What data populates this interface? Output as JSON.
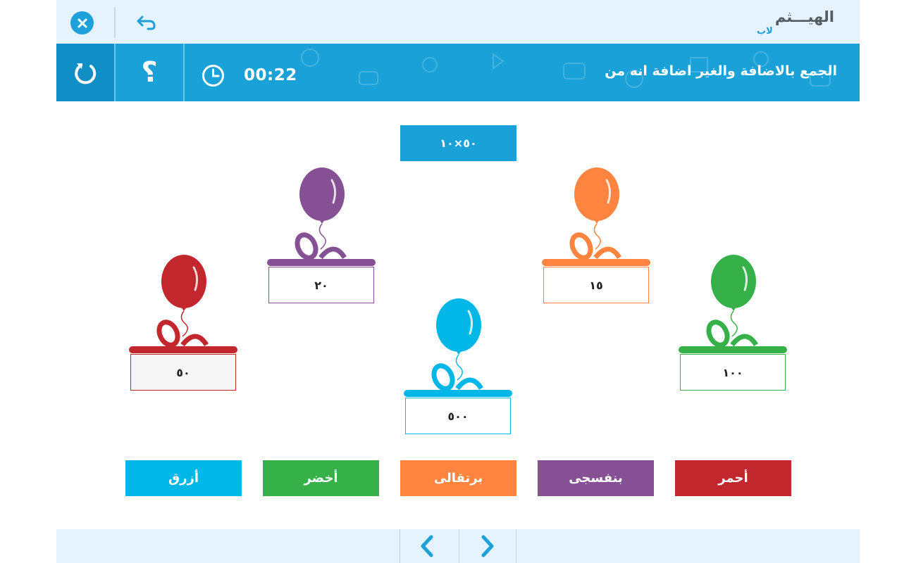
{
  "app": {
    "logo_text": "الهيـــثم",
    "logo_sub": "لاب"
  },
  "header": {
    "title": "الجمع بالاضافة والغير اضافة انه من",
    "timer": "00:22",
    "help_label": "؟"
  },
  "problem": {
    "text": "٥٠×١٠"
  },
  "gifts": [
    {
      "name": "red",
      "value": "٥٠",
      "color": "#c1272d"
    },
    {
      "name": "purple",
      "value": "٢٠",
      "color": "#855194"
    },
    {
      "name": "blue",
      "value": "٥٠٠",
      "color": "#00b7e8"
    },
    {
      "name": "orange",
      "value": "١٥",
      "color": "#fe843f"
    },
    {
      "name": "green",
      "value": "١٠٠",
      "color": "#36b14a"
    }
  ],
  "color_buttons": [
    {
      "label": "أزرق",
      "color": "#00b7e8"
    },
    {
      "label": "أخضر",
      "color": "#36b14a"
    },
    {
      "label": "برتقالى",
      "color": "#fe843f"
    },
    {
      "label": "بنفسجى",
      "color": "#855194"
    },
    {
      "label": "أحمر",
      "color": "#c1272d"
    }
  ],
  "icons": {
    "close": "close-icon",
    "back": "undo-arrow-icon",
    "reset": "reload-icon",
    "help": "question-mark-icon",
    "clock": "clock-icon",
    "prev": "chevron-left-icon",
    "next": "chevron-right-icon"
  },
  "colors": {
    "accent": "#1aa1d7",
    "bar_light": "#e4f3fd"
  }
}
